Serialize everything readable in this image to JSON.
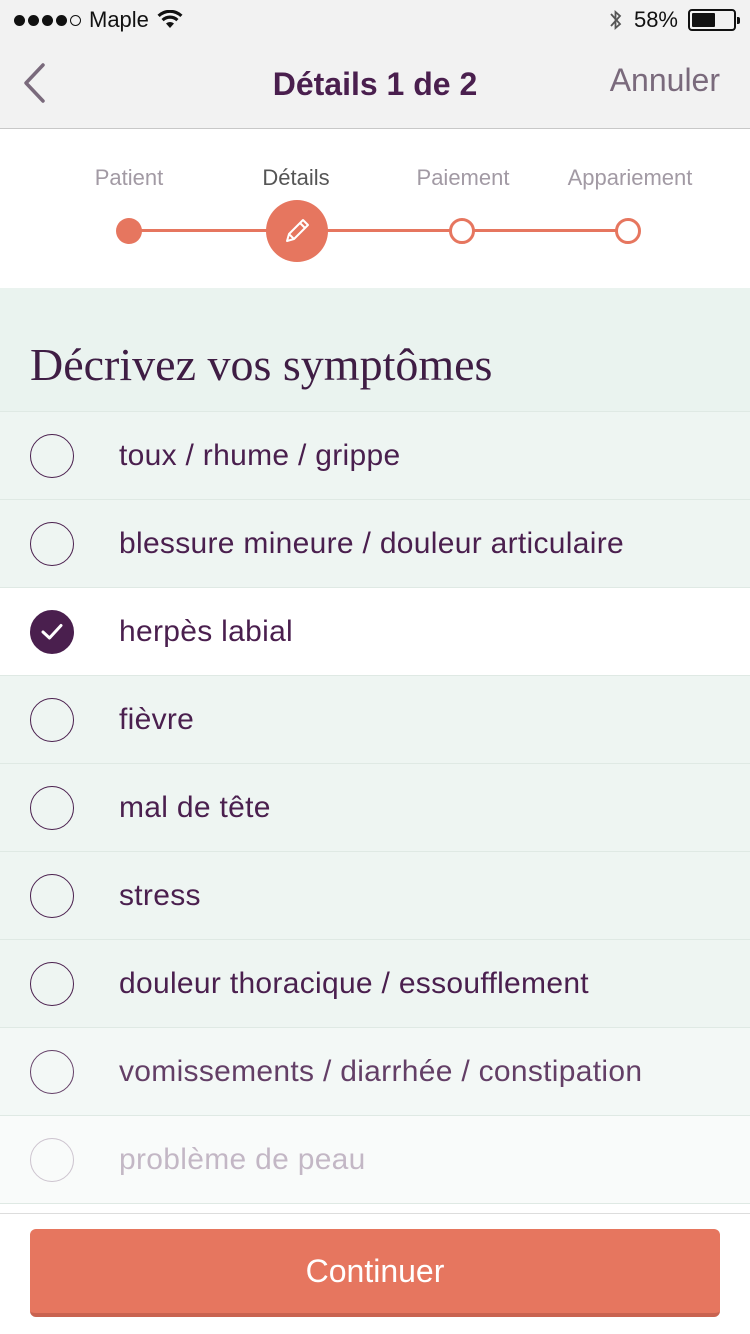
{
  "status_bar": {
    "carrier": "Maple",
    "battery_percent": "58%",
    "battery_level": 0.58
  },
  "nav": {
    "title": "Détails 1 de 2",
    "cancel_label": "Annuler"
  },
  "stepper": {
    "steps": [
      {
        "label": "Patient",
        "state": "done"
      },
      {
        "label": "Détails",
        "state": "current"
      },
      {
        "label": "Paiement",
        "state": "pending"
      },
      {
        "label": "Appariement",
        "state": "pending"
      }
    ]
  },
  "section": {
    "title": "Décrivez vos symptômes"
  },
  "symptoms": [
    {
      "label": "toux / rhume / grippe",
      "checked": false
    },
    {
      "label": "blessure mineure / douleur articulaire",
      "checked": false
    },
    {
      "label": "herpès labial",
      "checked": true
    },
    {
      "label": "fièvre",
      "checked": false
    },
    {
      "label": "mal de tête",
      "checked": false
    },
    {
      "label": "stress",
      "checked": false
    },
    {
      "label": "douleur thoracique / essoufflement",
      "checked": false
    },
    {
      "label": "vomissements / diarrhée / constipation",
      "checked": false
    },
    {
      "label": "problème de peau",
      "checked": false
    }
  ],
  "footer": {
    "continue_label": "Continuer"
  },
  "colors": {
    "accent": "#e6765f",
    "primary_text": "#4a1f4e",
    "list_background": "#eef5f2"
  }
}
